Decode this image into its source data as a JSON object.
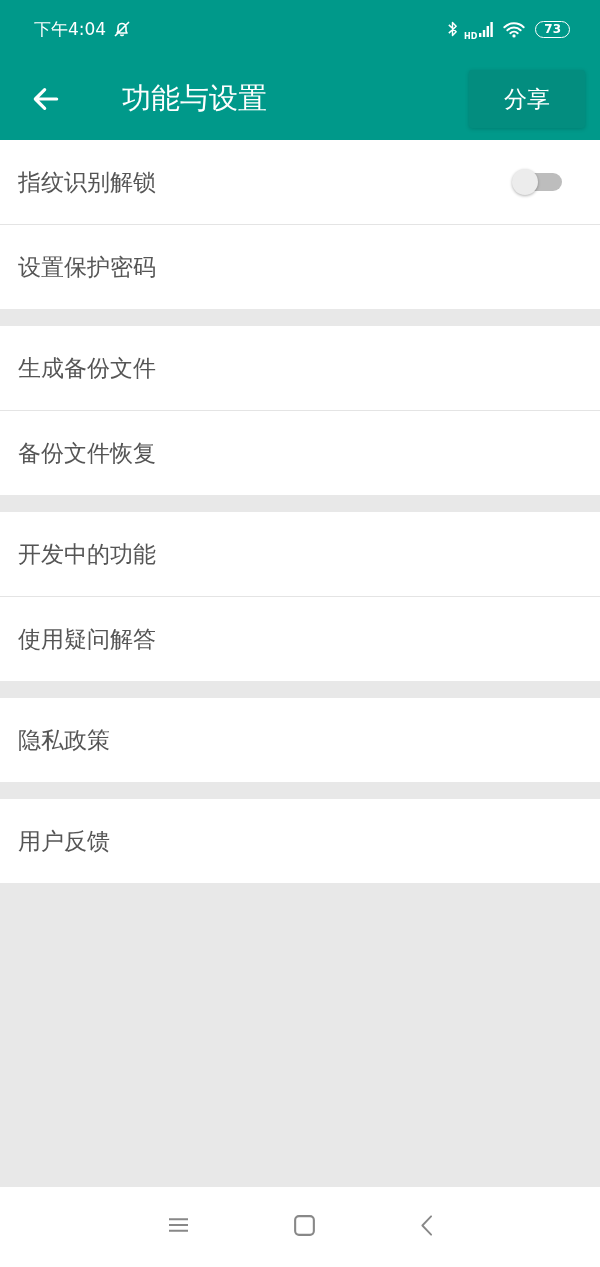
{
  "status_bar": {
    "time": "下午4:04",
    "signal_label": "HD",
    "battery": "73"
  },
  "app_bar": {
    "title": "功能与设置",
    "share_button": "分享"
  },
  "sections": [
    {
      "items": [
        {
          "kind": "toggle",
          "label": "指纹识别解锁",
          "on": false
        },
        {
          "kind": "link",
          "label": "设置保护密码"
        }
      ]
    },
    {
      "items": [
        {
          "kind": "link",
          "label": "生成备份文件"
        },
        {
          "kind": "link",
          "label": "备份文件恢复"
        }
      ]
    },
    {
      "items": [
        {
          "kind": "link",
          "label": "开发中的功能"
        },
        {
          "kind": "link",
          "label": "使用疑问解答"
        }
      ]
    },
    {
      "items": [
        {
          "kind": "link",
          "label": "隐私政策"
        }
      ]
    },
    {
      "items": [
        {
          "kind": "link",
          "label": "用户反馈"
        }
      ]
    }
  ]
}
